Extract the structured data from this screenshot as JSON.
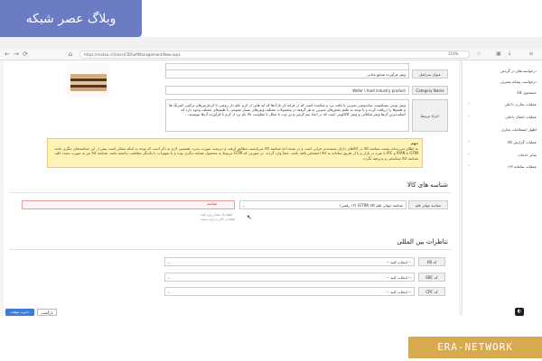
{
  "watermark_top": "وبلاگ عصر شبکه",
  "watermark_bottom": "ERA-NETWORK",
  "browser": {
    "url": "https://mataa.ir/Users/CIDSoftManagement/New.aspx",
    "zoom": "110%"
  },
  "sidebar": {
    "items": [
      {
        "label": "درخواست‌های در گردش",
        "arrow": false
      },
      {
        "label": "درخواست پیمانه مصرف",
        "arrow": false
      },
      {
        "label": "جستجوی کالا",
        "arrow": false
      },
      {
        "label": "عملیات تجارت داخلی",
        "arrow": true
      },
      {
        "label": "عملیات اتصال داخلی",
        "arrow": true
      },
      {
        "label": "اظهار استعلامات تجاری",
        "arrow": false
      },
      {
        "label": "عملیات گزارش کالا",
        "arrow": true
      },
      {
        "label": "سایر خدمات",
        "arrow": true
      },
      {
        "label": "عملیات سامانه ۱۲۴",
        "arrow": true
      }
    ]
  },
  "form": {
    "row_top_value": "",
    "title_label": "عنوان سرانمل",
    "title_value": "ویفر فرآورده صنایع غذایی",
    "category_label": "Category Name",
    "category_value": "Wafer \\ food industry product",
    "description_label": "اجزاء مرتبط",
    "description_value": "ویفر نوعی بیسکوئیت ساندویچی شیرین با بافت ترد و شکننده است که در فرانه ای نازک‌ها که ایه هایی از کرم جلم دار روغنی یا کرمارش‌های ترکیبی کمرنگ ها و طعم‌ها را دریافت کرده و با توجه به طعم بخش‌های شیرین به هر گرفته در محصولات مختلف ویفرهای بسیار متنوعی با طعم‌های مختلف وجود دارد که اصلیت‌ترین آن‌ها ویفر شکلاتی و ویفر کاکائویی است که در ابعاد نیم کرمی و پی وب با شکل یا مقاومت بالا نام برد از کرم تا فرآورده آن‌ها بنویسید..."
  },
  "note": {
    "title": "مهم",
    "text": "به اطلاع می‌رساند نسبت شناسه کالا در کالاهای دارای بسته‌بندی فرایی است و در نتیجه اخذ شناسه کالا می‌بایست مطابق کرفت و دیرست صورت پذیرد. همچنین لازم به ذکر است که توجه به اینکه ممکن است پیش از این شناسه‌های دیگری مانند GTIN یا IRAN و IRC یا غیره در بازار و یا از طریق سامانه به کالا اختصاص یافته باشد، حتماً وارد گردند. در صورتی که GTIN مربوط به محصول مشابه دیگری بوده و یا تجهیزات با یکدیگر مطابقت نداشته باشد، شناسه کالا نیز به صورت مجدد کلیه شناسه کالا شناسایی و پذیرفته نگردد."
  },
  "ident_section": {
    "title": "شناسه های کالا",
    "select_value": "شناسه جهانی قلم کالا (GTIN) (۱۳ رقمی)",
    "input_label": "شناسه",
    "help_line1": "لطفا یک مقدار وارد کنید",
    "help_line2": "لطفا در کادر را وارد نمایید"
  },
  "intl_section": {
    "title": "تناظرات بین المللی",
    "rows": [
      {
        "code": "HS کد",
        "placeholder": "-- انتخاب کنید --"
      },
      {
        "code": "EBC کد",
        "placeholder": "-- انتخاب کنید --"
      },
      {
        "code": "CPC کد",
        "placeholder": "-- انتخاب کنید --"
      }
    ]
  },
  "buttons": {
    "save": "ذخیره موقت",
    "back": "بازگشت"
  }
}
